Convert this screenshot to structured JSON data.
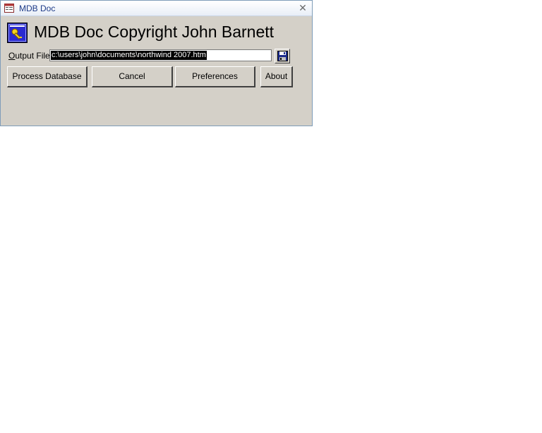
{
  "window": {
    "title": "MDB Doc",
    "close_glyph": "✕",
    "icons": {
      "app": "form-icon",
      "close": "close-icon"
    }
  },
  "header": {
    "heading": "MDB Doc Copyright John Barnett",
    "logo_icon": "database-key-icon"
  },
  "output": {
    "label_accel": "O",
    "label_rest": "utput File:",
    "value": "c:\\users\\john\\documents\\northwind 2007.htm",
    "save_icon": "save-disk-icon"
  },
  "buttons": {
    "process_label": "Process Database",
    "cancel_label": "Cancel",
    "preferences_label": "Preferences",
    "about_label": "About"
  },
  "colors": {
    "face": "#d4d0c8",
    "title_text": "#1f3c88",
    "selection_bg": "#000000",
    "selection_fg": "#ffffff"
  }
}
